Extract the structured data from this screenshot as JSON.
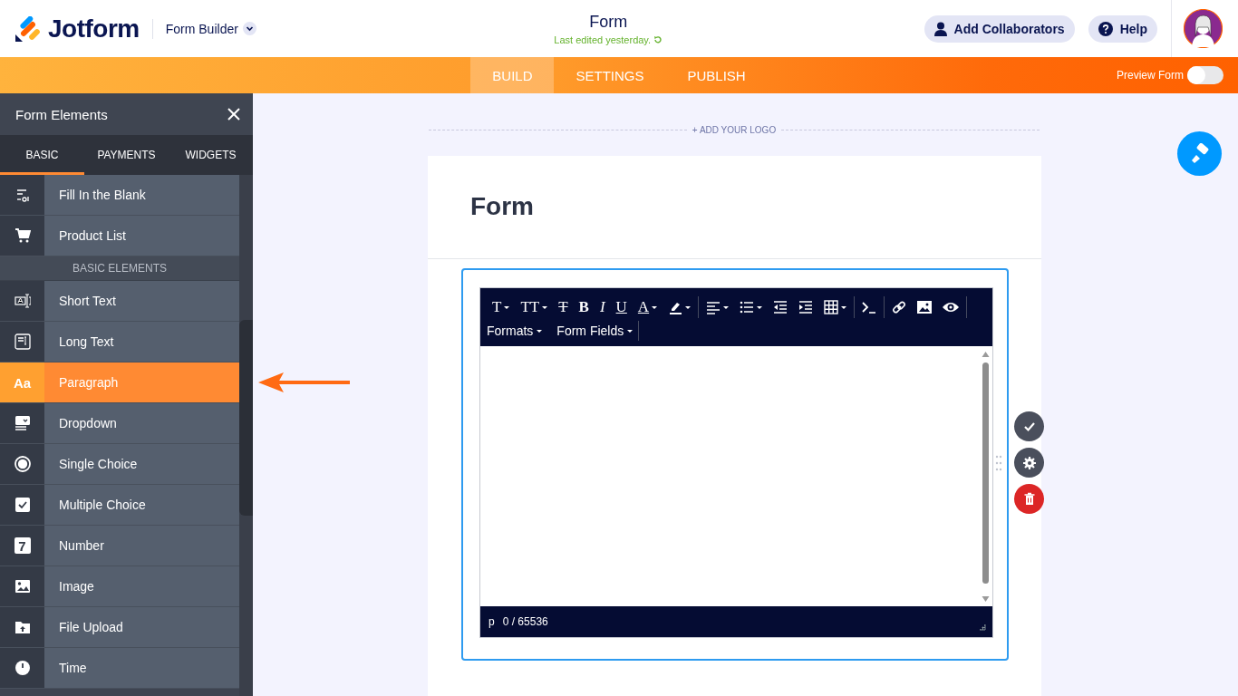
{
  "header": {
    "logo": "Jotform",
    "app_menu": "Form Builder",
    "title": "Form",
    "last_edited": "Last edited yesterday.",
    "buttons": [
      {
        "kind": "collaborators",
        "label": "Add Collaborators"
      },
      {
        "kind": "help",
        "label": "Help"
      }
    ]
  },
  "nav": {
    "tabs": [
      {
        "label": "BUILD",
        "selected": true
      },
      {
        "label": "SETTINGS",
        "selected": false
      },
      {
        "label": "PUBLISH",
        "selected": false
      }
    ],
    "preview": {
      "label": "Preview Form",
      "on": false
    }
  },
  "sidebar": {
    "title": "Form Elements",
    "tabs": [
      {
        "label": "BASIC",
        "selected": true
      },
      {
        "label": "PAYMENTS",
        "selected": false
      },
      {
        "label": "WIDGETS",
        "selected": false
      }
    ],
    "items": [
      {
        "kind": "blank",
        "label": "Fill In the Blank",
        "selected": false
      },
      {
        "kind": "cart",
        "label": "Product List",
        "selected": false
      },
      {
        "kind": "section",
        "label": "BASIC ELEMENTS"
      },
      {
        "kind": "shorttext",
        "label": "Short Text",
        "selected": false
      },
      {
        "kind": "longtext",
        "label": "Long Text",
        "selected": false
      },
      {
        "kind": "paragraph",
        "icon_text": "Aa",
        "label": "Paragraph",
        "selected": true
      },
      {
        "kind": "dropdown",
        "label": "Dropdown",
        "selected": false
      },
      {
        "kind": "radio",
        "label": "Single Choice",
        "selected": false
      },
      {
        "kind": "checkbox",
        "label": "Multiple Choice",
        "selected": false
      },
      {
        "kind": "number",
        "icon_text": "7",
        "label": "Number",
        "selected": false
      },
      {
        "kind": "image",
        "label": "Image",
        "selected": false
      },
      {
        "kind": "upload",
        "label": "File Upload",
        "selected": false
      },
      {
        "kind": "time",
        "label": "Time",
        "selected": false
      }
    ]
  },
  "form": {
    "logo_prompt": "+ ADD YOUR LOGO",
    "title": "Form",
    "editor": {
      "toolbar": [
        {
          "kind": "glyph",
          "text": "T",
          "caret": true
        },
        {
          "kind": "glyph",
          "text": "TT",
          "caret": true
        },
        {
          "kind": "strike",
          "text": "T",
          "caret": false
        },
        {
          "kind": "bold",
          "text": "B",
          "caret": false
        },
        {
          "kind": "italic",
          "text": "I",
          "caret": false
        },
        {
          "kind": "underline",
          "text": "U",
          "caret": false
        },
        {
          "kind": "underline",
          "text": "A",
          "caret": true
        },
        {
          "kind": "highlight",
          "caret": true
        },
        {
          "kind": "separator"
        },
        {
          "kind": "align",
          "caret": true
        },
        {
          "kind": "list",
          "caret": true
        },
        {
          "kind": "outdent",
          "caret": false
        },
        {
          "kind": "indent",
          "caret": false
        },
        {
          "kind": "table",
          "caret": true
        },
        {
          "kind": "separator"
        },
        {
          "kind": "code",
          "caret": false
        },
        {
          "kind": "separator"
        },
        {
          "kind": "link",
          "caret": false
        },
        {
          "kind": "image",
          "caret": false
        },
        {
          "kind": "preview",
          "caret": false
        },
        {
          "kind": "separator"
        }
      ],
      "menus": [
        "Formats",
        "Form Fields"
      ],
      "status_tag": "p",
      "char_count": "0 / 65536"
    }
  }
}
